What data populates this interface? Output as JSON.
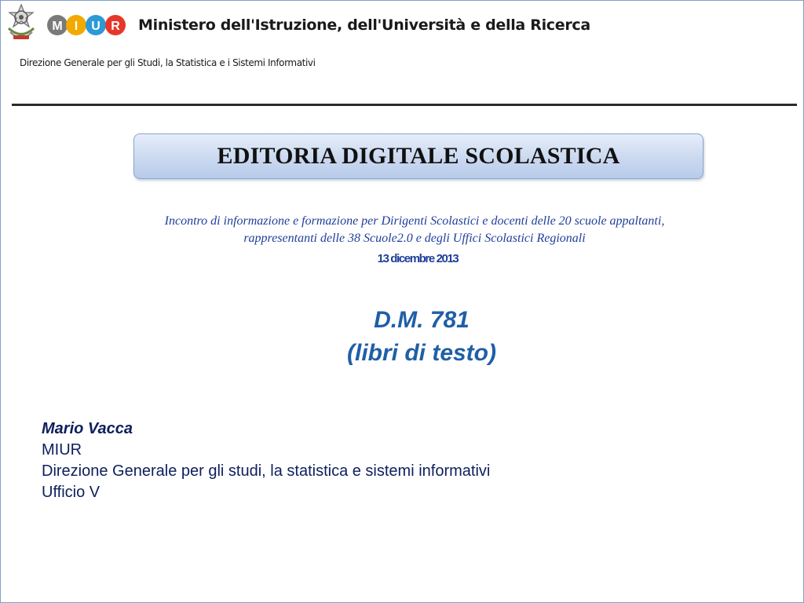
{
  "header": {
    "emblem_icon": "italian-republic-emblem-icon",
    "logo_letters": [
      "M",
      "I",
      "U",
      "R"
    ],
    "logo_colors": [
      "#7a7a7a",
      "#f2a900",
      "#2c9ad6",
      "#e6372a"
    ],
    "ministry_title": "Ministero dell'Istruzione, dell'Università e della Ricerca",
    "directorate": "Direzione Generale per gli Studi, la Statistica e i Sistemi Informativi"
  },
  "banner": {
    "title": "EDITORIA DIGITALE SCOLASTICA"
  },
  "intro": {
    "line1": "Incontro di informazione e formazione per Dirigenti Scolastici e docenti delle 20 scuole appaltanti,",
    "line2": "rappresentanti delle 38 Scuole2.0 e degli Uffici Scolastici Regionali",
    "date": "13 dicembre 2013"
  },
  "decree": {
    "line1": "D.M. 781",
    "line2": "(libri di testo)"
  },
  "author": {
    "name": "Mario Vacca",
    "org": "MIUR",
    "department": "Direzione Generale per gli studi, la statistica e  sistemi informativi",
    "office": "Ufficio V"
  },
  "colors": {
    "accent_blue": "#1f3f9a",
    "decree_blue": "#1f5fa6",
    "author_navy": "#0d1f5c",
    "frame_border": "#7f9fc7"
  }
}
